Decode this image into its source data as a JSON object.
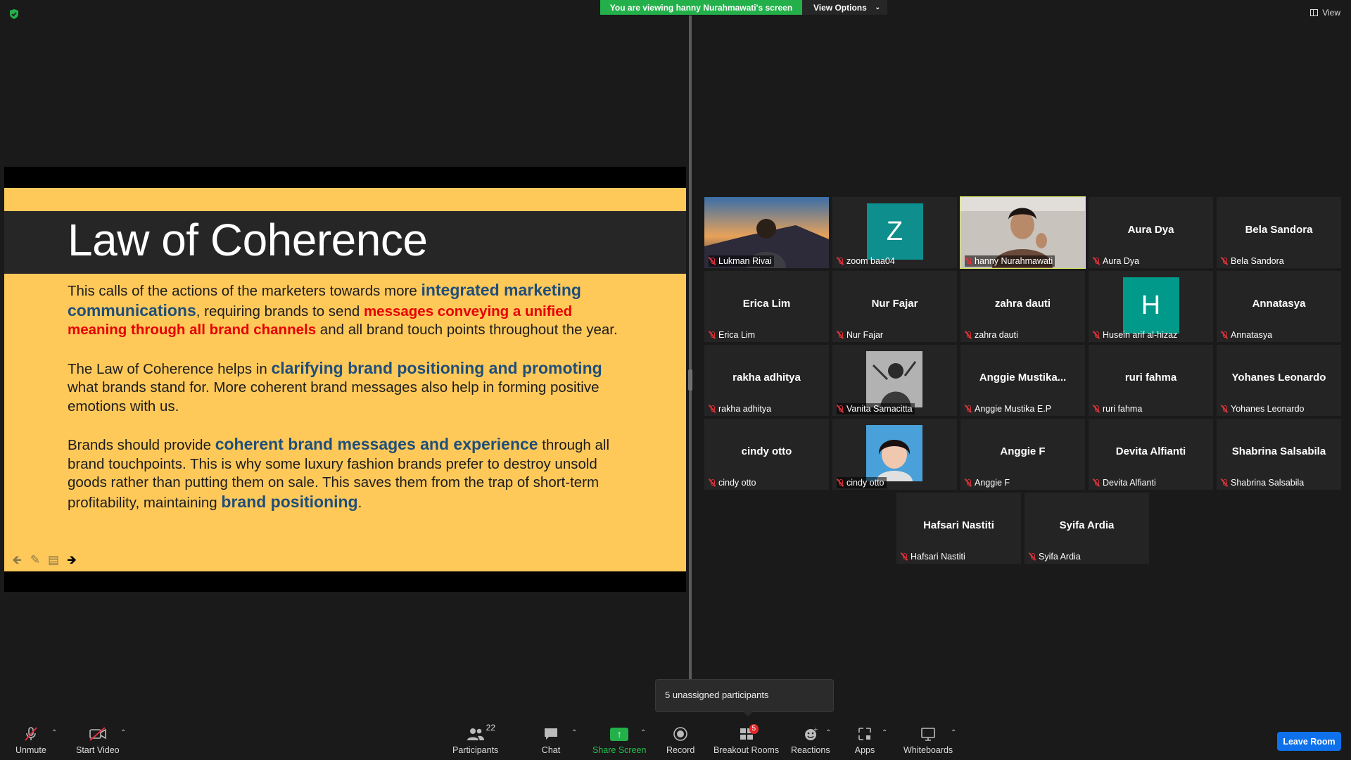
{
  "banner": {
    "viewing_text": "You are viewing hanny Nurahmawati's screen",
    "view_options": "View Options",
    "view_label": "View"
  },
  "colors": {
    "banner_green": "#23b04a",
    "slide_bg": "#ffc95a",
    "title_bar": "#262626",
    "highlight_blue": "#1f4e79",
    "highlight_red": "#e60000",
    "leave_blue": "#0e71eb",
    "speaking_outline": "#d7e860"
  },
  "slide": {
    "title": "Law of Coherence",
    "p1": {
      "a": "This calls of the actions of the marketers towards more ",
      "b": "integrated marketing communications",
      "c": ", requiring brands to send ",
      "d": "messages conveying a unified meaning through all brand channels",
      "e": " and all brand touch points throughout the year."
    },
    "p2": {
      "a": "The Law of Coherence helps in ",
      "b": "clarifying brand positioning and promoting",
      "c": " what brands stand for. More coherent brand messages also help in forming positive emotions  with us."
    },
    "p3": {
      "a": "Brands should provide ",
      "b": "coherent brand messages and experience",
      "c": " through all brand touchpoints. This is why some luxury fashion brands prefer to destroy unsold goods rather than putting them on sale. This saves them from the trap of short-term profitability, maintaining ",
      "d": "brand positioning",
      "e": "."
    }
  },
  "participants": [
    {
      "center": "",
      "label": "Lukman Rivai"
    },
    {
      "center": "Z",
      "label": "zoom baa04"
    },
    {
      "center": "",
      "label": "hanny Nurahmawati"
    },
    {
      "center": "Aura Dya",
      "label": "Aura Dya"
    },
    {
      "center": "Bela Sandora",
      "label": "Bela Sandora"
    },
    {
      "center": "Erica Lim",
      "label": "Erica Lim"
    },
    {
      "center": "Nur Fajar",
      "label": "Nur Fajar"
    },
    {
      "center": "zahra dauti",
      "label": "zahra dauti"
    },
    {
      "center": "H",
      "label": "Husein arif al-hizaz"
    },
    {
      "center": "Annatasya",
      "label": "Annatasya"
    },
    {
      "center": "rakha adhitya",
      "label": "rakha adhitya"
    },
    {
      "center": "",
      "label": "Vanita Samacitta"
    },
    {
      "center": "Anggie  Mustika...",
      "label": "Anggie Mustika E.P"
    },
    {
      "center": "ruri fahma",
      "label": "ruri fahma"
    },
    {
      "center": "Yohanes Leonardo",
      "label": "Yohanes Leonardo"
    },
    {
      "center": "cindy otto",
      "label": "cindy otto"
    },
    {
      "center": "",
      "label": "cindy otto"
    },
    {
      "center": "Anggie F",
      "label": "Anggie F"
    },
    {
      "center": "Devita Alfianti",
      "label": "Devita Alfianti"
    },
    {
      "center": "Shabrina Salsabila",
      "label": "Shabrina Salsabila"
    },
    {
      "center": "Hafsari Nastiti",
      "label": "Hafsari Nastiti"
    },
    {
      "center": "Syifa Ardia",
      "label": "Syifa Ardia"
    }
  ],
  "popup": {
    "text": "5 unassigned participants"
  },
  "toolbar": {
    "unmute": "Unmute",
    "start_video": "Start Video",
    "participants": "Participants",
    "participants_count": "22",
    "chat": "Chat",
    "share_screen": "Share Screen",
    "record": "Record",
    "breakout_rooms": "Breakout Rooms",
    "breakout_badge": "5",
    "reactions": "Reactions",
    "apps": "Apps",
    "whiteboards": "Whiteboards",
    "leave": "Leave Room"
  }
}
